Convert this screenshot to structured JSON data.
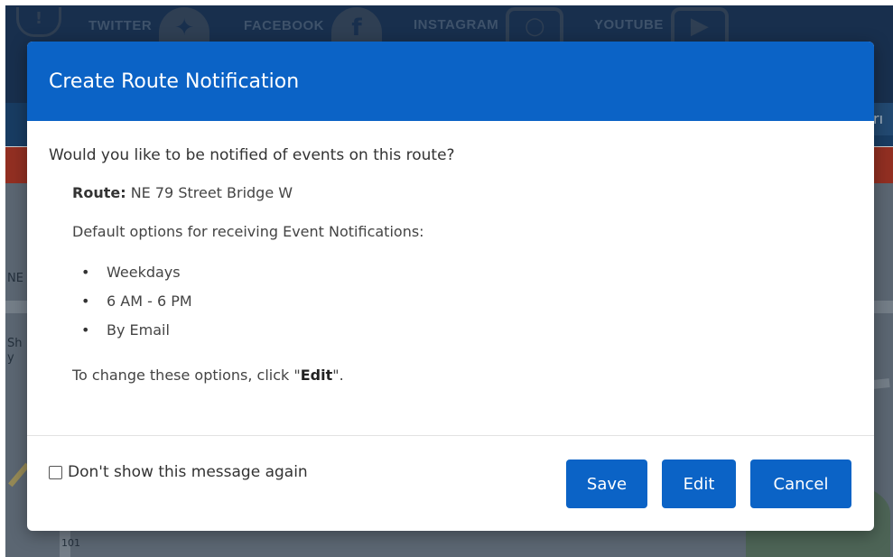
{
  "background": {
    "social_links": [
      {
        "label": "TWITTER",
        "icon": "twitter-bird-icon"
      },
      {
        "label": "FACEBOOK",
        "icon": "facebook-f-icon"
      },
      {
        "label": "INSTAGRAM",
        "icon": "instagram-camera-icon"
      },
      {
        "label": "YOUTUBE",
        "icon": "youtube-play-icon"
      }
    ],
    "map_labels": [
      "NE",
      "Sh",
      "y",
      "101"
    ]
  },
  "modal": {
    "title": "Create Route Notification",
    "question": "Would you like to be notified of events on this route?",
    "route_label": "Route:",
    "route_value": "NE 79 Street Bridge W",
    "defaults_text": "Default options for receiving Event Notifications:",
    "options": [
      "Weekdays",
      "6 AM - 6 PM",
      "By Email"
    ],
    "change_prefix": "To change these options, click \"",
    "change_bold": "Edit",
    "change_suffix": "\".",
    "dont_show_label": "Don't show this message again",
    "dont_show_checked": false,
    "buttons": {
      "save": "Save",
      "edit": "Edit",
      "cancel": "Cancel"
    }
  },
  "colors": {
    "accent": "#0b63c6",
    "header_text": "#ffffff",
    "body_text": "#333333"
  }
}
